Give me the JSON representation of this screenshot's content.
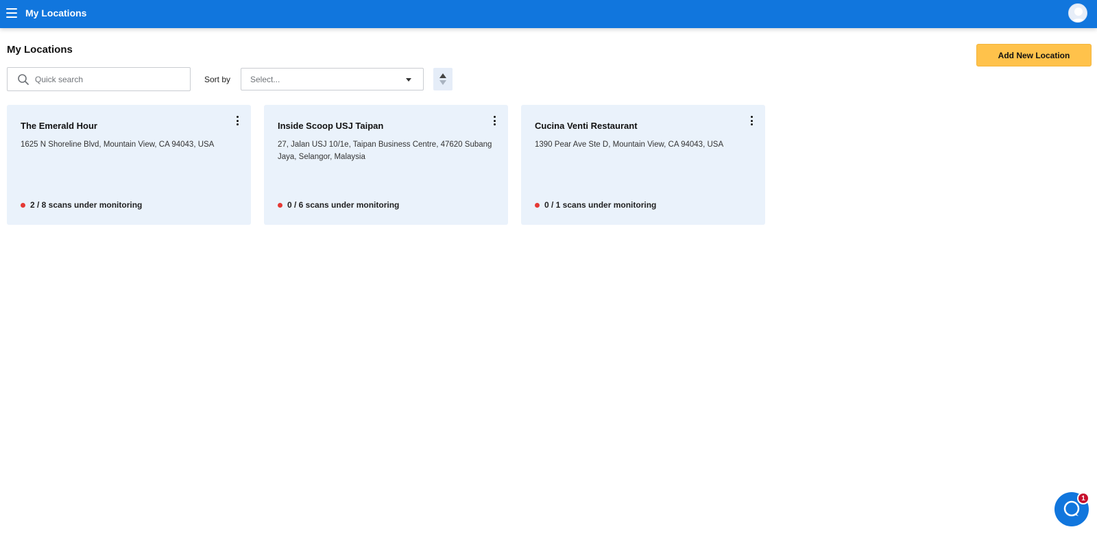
{
  "header": {
    "title": "My Locations",
    "menu_icon": "hamburger-menu-icon",
    "avatar_icon": "user-avatar-icon",
    "bar_color": "#1176dd"
  },
  "page": {
    "title": "My Locations",
    "add_button_label": "Add New Location",
    "add_button_color": "#ffc24b"
  },
  "toolbar": {
    "search_placeholder": "Quick search",
    "search_value": "",
    "sort_label": "Sort by",
    "sort_placeholder": "Select...",
    "sort_direction_icon": "sort-direction-icon"
  },
  "locations": [
    {
      "name": "The Emerald Hour",
      "address": "1625 N Shoreline Blvd, Mountain View, CA 94043, USA",
      "status": "2 / 8 scans under monitoring"
    },
    {
      "name": "Inside Scoop USJ Taipan",
      "address": "27, Jalan USJ 10/1e, Taipan Business Centre, 47620 Subang Jaya, Selangor, Malaysia",
      "status": "0 / 6 scans under monitoring"
    },
    {
      "name": "Cucina Venti Restaurant",
      "address": "1390 Pear Ave Ste D, Mountain View, CA 94043, USA",
      "status": "0 / 1 scans under monitoring"
    }
  ],
  "status_dot_color": "#e53935",
  "chat": {
    "icon": "chat-bubble-icon",
    "badge_count": "1"
  }
}
